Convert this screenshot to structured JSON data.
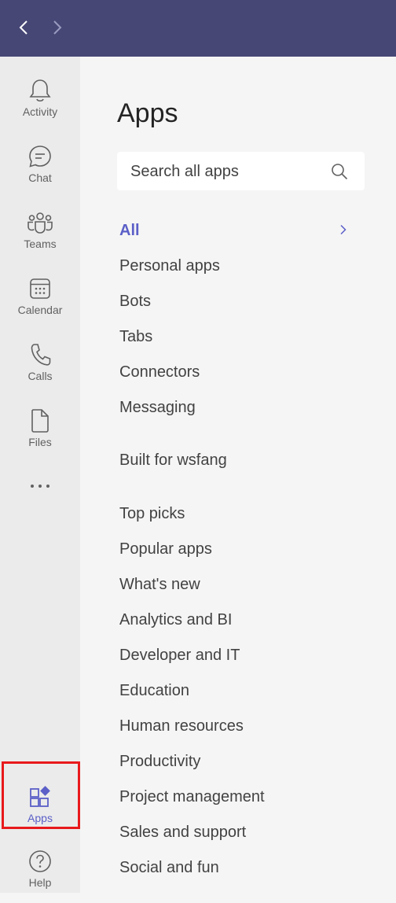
{
  "rail": {
    "items": [
      {
        "label": "Activity",
        "icon": "bell-icon"
      },
      {
        "label": "Chat",
        "icon": "chat-icon"
      },
      {
        "label": "Teams",
        "icon": "teams-icon"
      },
      {
        "label": "Calendar",
        "icon": "calendar-icon"
      },
      {
        "label": "Calls",
        "icon": "phone-icon"
      },
      {
        "label": "Files",
        "icon": "file-icon"
      }
    ],
    "more": "more-icon",
    "apps": {
      "label": "Apps",
      "icon": "apps-icon"
    },
    "help": {
      "label": "Help",
      "icon": "help-icon"
    }
  },
  "main": {
    "title": "Apps",
    "search": {
      "placeholder": "Search all apps"
    },
    "categories": {
      "all": "All",
      "personal": "Personal apps",
      "bots": "Bots",
      "tabs": "Tabs",
      "connectors": "Connectors",
      "messaging": "Messaging",
      "built_for": "Built for wsfang",
      "top_picks": "Top picks",
      "popular": "Popular apps",
      "whats_new": "What's new",
      "analytics": "Analytics and BI",
      "developer": "Developer and IT",
      "education": "Education",
      "hr": "Human resources",
      "productivity": "Productivity",
      "project": "Project management",
      "sales": "Sales and support",
      "social": "Social and fun"
    }
  },
  "colors": {
    "topbar": "#464775",
    "accent": "#5b5fc7",
    "highlight": "#e8191c"
  }
}
